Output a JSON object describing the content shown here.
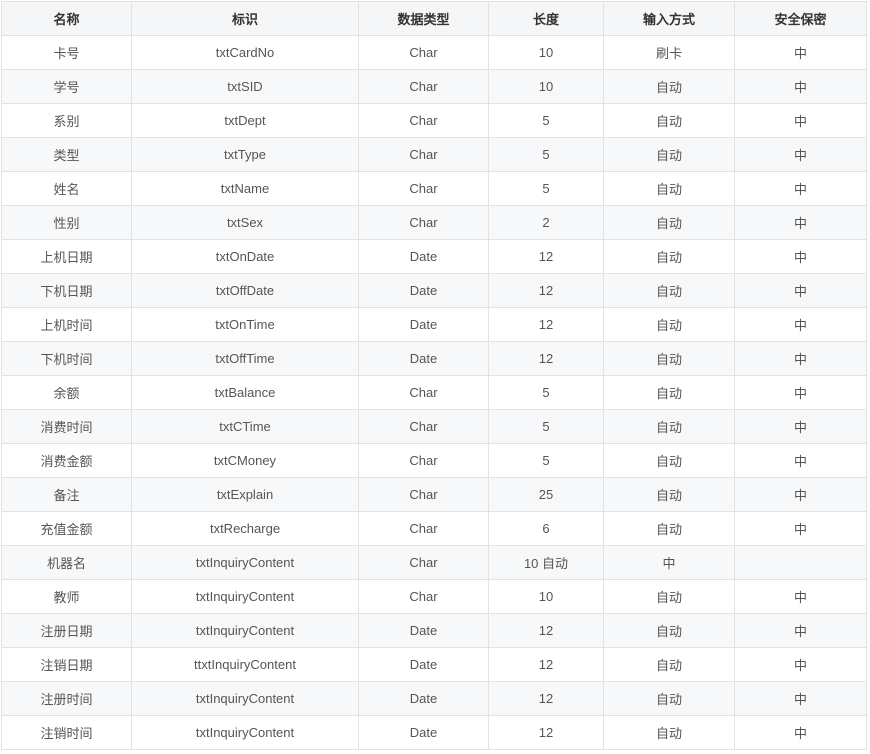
{
  "headers": [
    "名称",
    "标识",
    "数据类型",
    "长度",
    "输入方式",
    "安全保密"
  ],
  "rows": [
    [
      "卡号",
      "txtCardNo",
      "Char",
      "10",
      "刷卡",
      "中"
    ],
    [
      "学号",
      "txtSID",
      "Char",
      "10",
      "自动",
      "中"
    ],
    [
      "系别",
      "txtDept",
      "Char",
      "5",
      "自动",
      "中"
    ],
    [
      "类型",
      "txtType",
      "Char",
      "5",
      "自动",
      "中"
    ],
    [
      "姓名",
      "txtName",
      "Char",
      "5",
      "自动",
      "中"
    ],
    [
      "性别",
      "txtSex",
      "Char",
      "2",
      "自动",
      "中"
    ],
    [
      "上机日期",
      "txtOnDate",
      "Date",
      "12",
      "自动",
      "中"
    ],
    [
      "下机日期",
      "txtOffDate",
      "Date",
      "12",
      "自动",
      "中"
    ],
    [
      "上机时间",
      "txtOnTime",
      "Date",
      "12",
      "自动",
      "中"
    ],
    [
      "下机时间",
      "txtOffTime",
      "Date",
      "12",
      "自动",
      "中"
    ],
    [
      "余额",
      "txtBalance",
      "Char",
      "5",
      "自动",
      "中"
    ],
    [
      "消费时间",
      "txtCTime",
      "Char",
      "5",
      "自动",
      "中"
    ],
    [
      "消费金额",
      "txtCMoney",
      "Char",
      "5",
      "自动",
      "中"
    ],
    [
      "备注",
      "txtExplain",
      "Char",
      "25",
      "自动",
      "中"
    ],
    [
      "充值金额",
      "txtRecharge",
      "Char",
      "6",
      "自动",
      "中"
    ],
    [
      "机器名",
      "txtInquiryContent",
      "Char",
      "10 自动",
      "中",
      ""
    ],
    [
      "教师",
      "txtInquiryContent",
      "Char",
      "10",
      "自动",
      "中"
    ],
    [
      "注册日期",
      "txtInquiryContent",
      "Date",
      "12",
      "自动",
      "中"
    ],
    [
      "注销日期",
      "ttxtInquiryContent",
      "Date",
      "12",
      "自动",
      "中"
    ],
    [
      "注册时间",
      "txtInquiryContent",
      "Date",
      "12",
      "自动",
      "中"
    ],
    [
      "注销时间",
      "txtInquiryContent",
      "Date",
      "12",
      "自动",
      "中"
    ]
  ]
}
